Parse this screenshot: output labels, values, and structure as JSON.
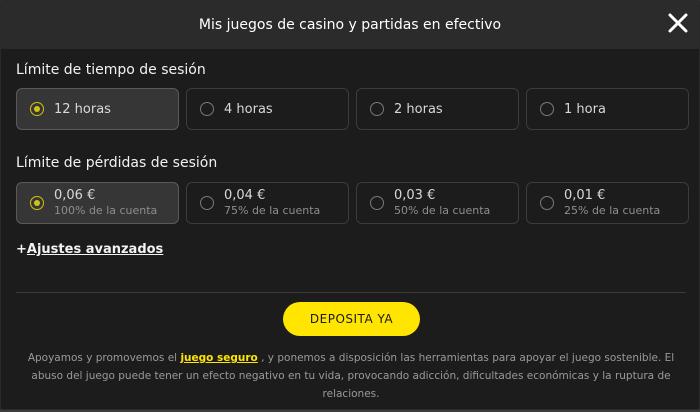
{
  "header": {
    "title": "Mis juegos de casino y partidas en efectivo",
    "close_icon": "close-icon"
  },
  "session_time": {
    "title": "Límite de tiempo de sesión",
    "options": [
      {
        "label": "12 horas",
        "selected": true
      },
      {
        "label": "4 horas",
        "selected": false
      },
      {
        "label": "2 horas",
        "selected": false
      },
      {
        "label": "1 hora",
        "selected": false
      }
    ]
  },
  "session_loss": {
    "title": "Límite de pérdidas de sesión",
    "options": [
      {
        "label": "0,06 €",
        "sub": "100% de la cuenta",
        "selected": true
      },
      {
        "label": "0,04 €",
        "sub": "75% de la cuenta",
        "selected": false
      },
      {
        "label": "0,03 €",
        "sub": "50% de la cuenta",
        "selected": false
      },
      {
        "label": "0,01 €",
        "sub": "25% de la cuenta",
        "selected": false
      }
    ]
  },
  "advanced": {
    "prefix": "+",
    "label": "Ajustes avanzados"
  },
  "deposit_button": {
    "label": "DEPOSITA YA"
  },
  "footer": {
    "text_before": "Apoyamos y promovemos el",
    "link": "juego seguro",
    "text_after": ", y ponemos a disposición las herramientas para apoyar el juego sostenible. El abuso del juego puede tener un efecto negativo en tu vida, provocando adicción, dificultades económicas y la ruptura de relaciones."
  },
  "colors": {
    "accent": "#ffe500",
    "radio_selected": "#cfc410",
    "background": "#1c1c1c",
    "header": "#2b2b2b"
  }
}
